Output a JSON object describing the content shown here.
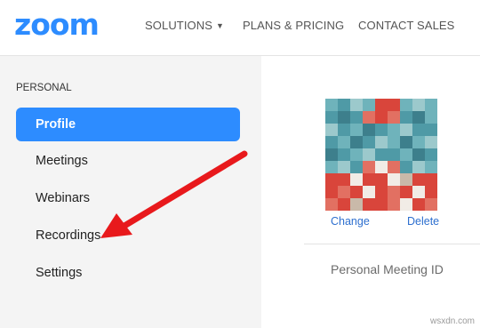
{
  "brand": {
    "logo": "zoom",
    "color": "#2d8cff"
  },
  "topnav": {
    "solutions": "SOLUTIONS",
    "plans": "PLANS & PRICING",
    "contact": "CONTACT SALES"
  },
  "sidebar": {
    "heading": "PERSONAL",
    "items": [
      {
        "label": "Profile",
        "active": true
      },
      {
        "label": "Meetings"
      },
      {
        "label": "Webinars"
      },
      {
        "label": "Recordings"
      },
      {
        "label": "Settings"
      }
    ]
  },
  "profile": {
    "change": "Change",
    "delete": "Delete",
    "pmi_label": "Personal Meeting ID"
  },
  "annotation": {
    "arrow_color": "#e8191c",
    "points_to": "Recordings"
  },
  "watermark": "wsxdn.com"
}
